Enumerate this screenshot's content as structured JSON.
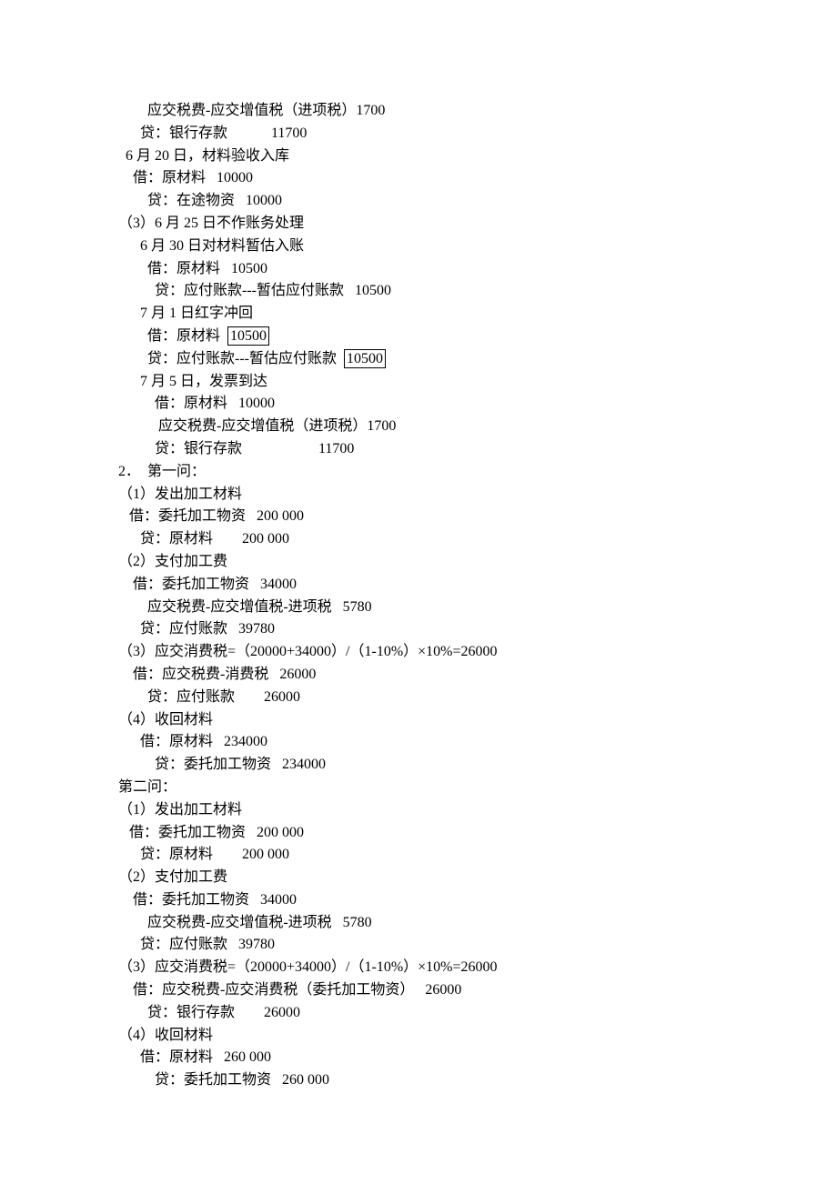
{
  "lines": [
    {
      "indent": 4,
      "text": "应交税费-应交增值税（进项税）1700"
    },
    {
      "indent": 3,
      "text": "贷：银行存款            11700"
    },
    {
      "indent": 1,
      "text": "6 月 20 日，材料验收入库"
    },
    {
      "indent": 2,
      "text": "借：原材料   10000"
    },
    {
      "indent": 4,
      "text": "贷：在途物资   10000"
    },
    {
      "indent": 0,
      "text": "（3）6 月 25 日不作账务处理"
    },
    {
      "indent": 3,
      "text": "6 月 30 日对材料暂估入账"
    },
    {
      "indent": 4,
      "text": "借：原材料   10500"
    },
    {
      "indent": 5,
      "text": "贷：应付账款---暂估应付账款   10500"
    },
    {
      "indent": 3,
      "text": "7 月 1 日红字冲回"
    },
    {
      "indent": 4,
      "segments": [
        {
          "t": "借：原材料  "
        },
        {
          "t": "10500",
          "boxed": true
        }
      ]
    },
    {
      "indent": 4,
      "segments": [
        {
          "t": "贷：应付账款---暂估应付账款  "
        },
        {
          "t": "10500",
          "boxed": true
        }
      ]
    },
    {
      "indent": 3,
      "text": "7 月 5 日，发票到达"
    },
    {
      "indent": 4,
      "text": "  借：原材料   10000"
    },
    {
      "indent": 4,
      "text": "   应交税费-应交增值税（进项税）1700"
    },
    {
      "indent": 4,
      "text": "  贷：银行存款                     11700"
    },
    {
      "indent": 0,
      "text": "2．  第一问："
    },
    {
      "indent": 0,
      "text": "（1）发出加工材料"
    },
    {
      "indent": 1,
      "text": " 借：委托加工物资   200 000"
    },
    {
      "indent": 3,
      "text": "贷：原材料        200 000"
    },
    {
      "indent": 0,
      "text": "（2）支付加工费"
    },
    {
      "indent": 2,
      "text": "借：委托加工物资   34000"
    },
    {
      "indent": 4,
      "text": "应交税费-应交增值税-进项税   5780"
    },
    {
      "indent": 3,
      "text": "贷：应付账款   39780"
    },
    {
      "indent": 0,
      "text": "（3）应交消费税=（20000+34000）/（1-10%）×10%=26000"
    },
    {
      "indent": 2,
      "text": "借：应交税费-消费税   26000"
    },
    {
      "indent": 4,
      "text": "贷：应付账款        26000"
    },
    {
      "indent": 0,
      "text": "（4）收回材料"
    },
    {
      "indent": 3,
      "text": "借：原材料   234000"
    },
    {
      "indent": 4,
      "text": "  贷：委托加工物资   234000"
    },
    {
      "indent": 0,
      "text": "第二问："
    },
    {
      "indent": 0,
      "text": "（1）发出加工材料"
    },
    {
      "indent": 1,
      "text": " 借：委托加工物资   200 000"
    },
    {
      "indent": 3,
      "text": "贷：原材料        200 000"
    },
    {
      "indent": 0,
      "text": "（2）支付加工费"
    },
    {
      "indent": 2,
      "text": "借：委托加工物资   34000"
    },
    {
      "indent": 4,
      "text": "应交税费-应交增值税-进项税   5780"
    },
    {
      "indent": 3,
      "text": "贷：应付账款   39780"
    },
    {
      "indent": 0,
      "text": "（3）应交消费税=（20000+34000）/（1-10%）×10%=26000"
    },
    {
      "indent": 2,
      "text": "借：应交税费-应交消费税（委托加工物资）   26000"
    },
    {
      "indent": 4,
      "text": "贷：银行存款        26000"
    },
    {
      "indent": 0,
      "text": "（4）收回材料"
    },
    {
      "indent": 3,
      "text": "借：原材料   260 000"
    },
    {
      "indent": 4,
      "text": "  贷：委托加工物资   260 000"
    }
  ],
  "indentUnit": "  "
}
